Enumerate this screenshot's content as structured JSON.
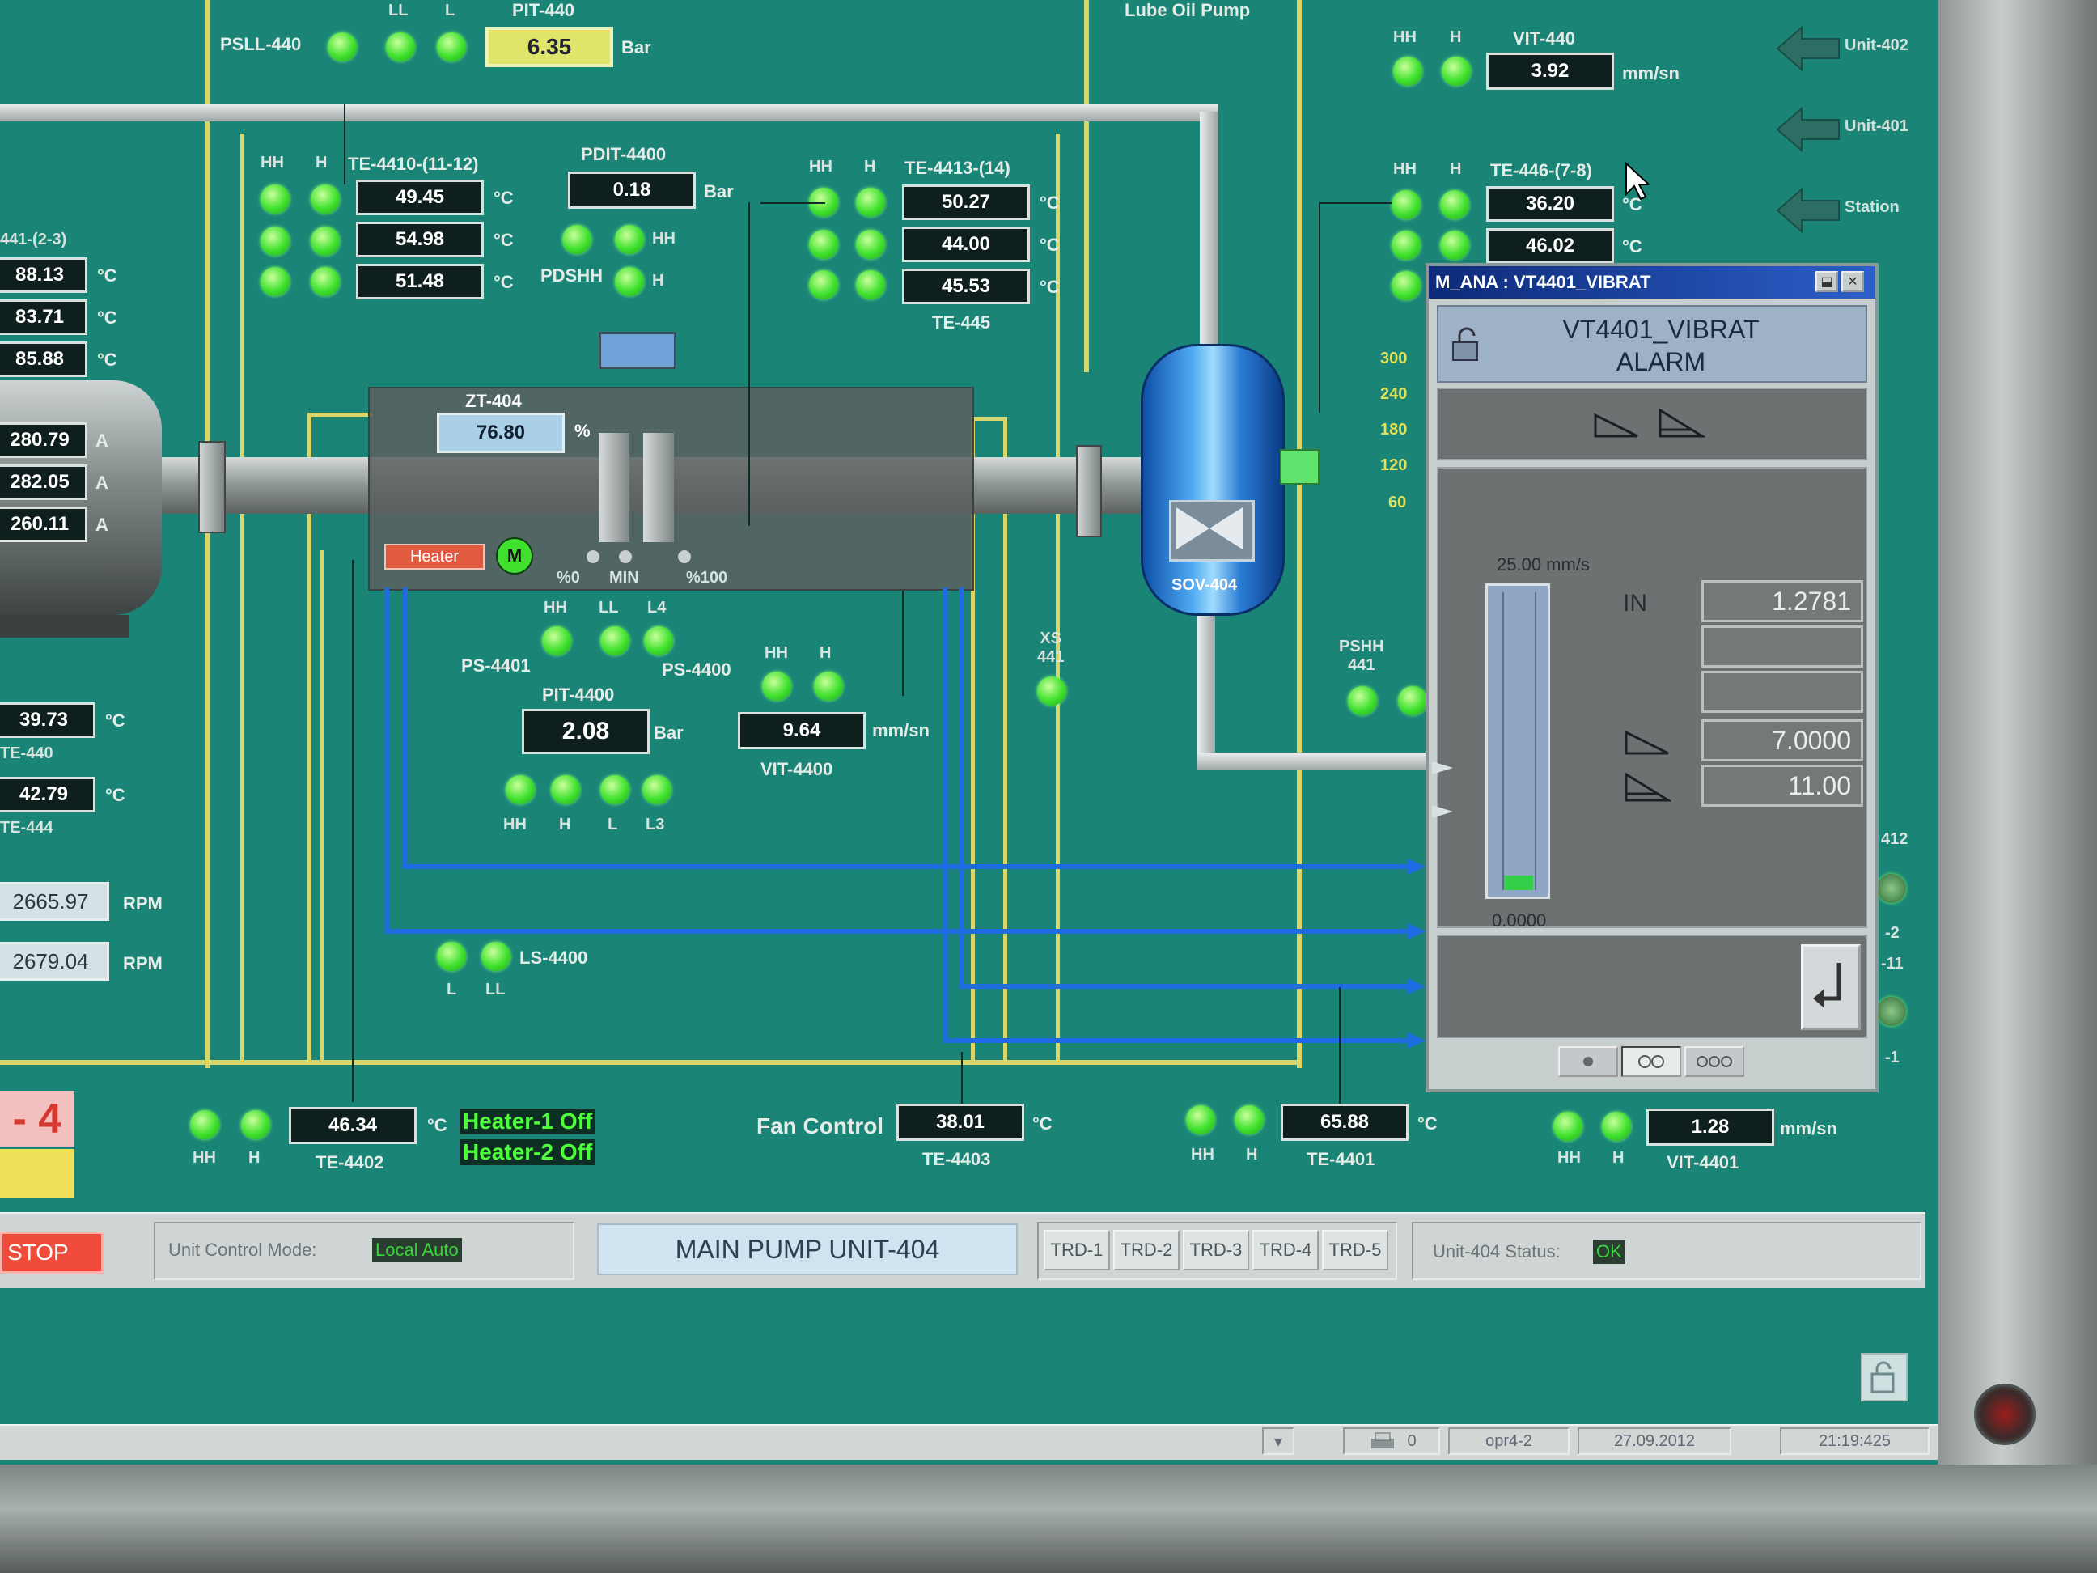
{
  "top": {
    "psll_label": "PSLL-440",
    "ll_label": "LL",
    "l_label": "L",
    "pit440_tag": "PIT-440",
    "pit440_value": "6.35",
    "pit440_unit": "Bar",
    "lube_oil_label": "Lube Oil Pump",
    "vit440_tag": "VIT-440",
    "vit440_value": "3.92",
    "vit440_unit": "mm/sn",
    "hh": "HH",
    "h": "H"
  },
  "right_nav": {
    "unit402": "Unit-402",
    "unit401": "Unit-401",
    "station": "Station"
  },
  "left_temps": {
    "tag": "441-(2-3)",
    "values": [
      "88.13",
      "83.71",
      "85.88"
    ],
    "unit": "°C",
    "amps": [
      "280.79",
      "282.05",
      "260.11"
    ],
    "amp_unit": "A",
    "te440_value": "39.73",
    "te440_tag": "TE-440",
    "te444_value": "42.79",
    "te444_tag": "TE-444",
    "rpm_values": [
      "2665.97",
      "2679.04"
    ],
    "rpm_unit": "RPM"
  },
  "te4410": {
    "tag": "TE-4410-(11-12)",
    "values": [
      "49.45",
      "54.98",
      "51.48"
    ],
    "unit": "°C"
  },
  "pdit4400": {
    "tag": "PDIT-4400",
    "value": "0.18",
    "unit": "Bar",
    "pdshh": "PDSHH",
    "hh": "HH",
    "h": "H"
  },
  "te4413": {
    "tag": "TE-4413-(14)",
    "values": [
      "50.27",
      "44.00",
      "45.53"
    ],
    "unit": "°C",
    "te445": "TE-445"
  },
  "te446": {
    "tag": "TE-446-(7-8)",
    "values": [
      "36.20",
      "46.02"
    ],
    "unit": "°C"
  },
  "pump": {
    "zt_tag": "ZT-404",
    "zt_value": "76.80",
    "zt_unit": "%",
    "heater": "Heater",
    "motor": "M",
    "pos0": "%0",
    "min": "MIN",
    "pos100": "%100"
  },
  "sov": {
    "label": "SOV-404"
  },
  "gauge_scale": [
    "300",
    "240",
    "180",
    "120",
    "60"
  ],
  "ps": {
    "ps4401": "PS-4401",
    "ps4400": "PS-4400",
    "hh": "HH",
    "ll": "LL",
    "l4": "L4",
    "pit4400_tag": "PIT-4400",
    "pit4400_value": "2.08",
    "pit4400_unit": "Bar",
    "vit4400_value": "9.64",
    "vit4400_unit": "mm/sn",
    "vit4400_tag": "VIT-4400",
    "h": "H",
    "l": "L",
    "l3": "L3",
    "xs441": "XS\n441",
    "pshh441": "PSHH\n441"
  },
  "ls4400": {
    "tag": "LS-4400",
    "l": "L",
    "ll": "LL"
  },
  "bottom": {
    "te4402_value": "46.34",
    "te4402_tag": "TE-4402",
    "heater1": "Heater-1 Off",
    "heater2": "Heater-2 Off",
    "fan_control": "Fan Control",
    "te4403_value": "38.01",
    "te4403_tag": "TE-4403",
    "te4401_value": "65.88",
    "te4401_tag": "TE-4401",
    "vit4401_value": "1.28",
    "vit4401_unit": "mm/sn",
    "vit4401_tag": "VIT-4401",
    "unit_big": "- 4",
    "side_labels": [
      "412",
      "-2",
      "-11",
      "-1"
    ]
  },
  "popup": {
    "title": "M_ANA : VT4401_VIBRAT",
    "name_line1": "VT4401_VIBRAT",
    "name_line2": "ALARM",
    "range_max": "25.00 mm/s",
    "range_min": "0.0000",
    "in_label": "IN",
    "in_value": "1.2781",
    "limit_h": "7.0000",
    "limit_hh": "11.00",
    "bar_fraction": 0.05
  },
  "control_bar": {
    "stop": "STOP",
    "mode_label": "Unit Control Mode:",
    "mode_value": "Local Auto",
    "title": "MAIN PUMP UNIT-404",
    "trd": [
      "TRD-1",
      "TRD-2",
      "TRD-3",
      "TRD-4",
      "TRD-5"
    ],
    "status_label": "Unit-404 Status:",
    "status_value": "OK"
  },
  "status_bar": {
    "count": "0",
    "user": "opr4-2",
    "date": "27.09.2012",
    "time": "21:19:425"
  },
  "colors": {
    "background": "#1a8577",
    "led": "#3fe12e",
    "flow_line": "#1f6be0",
    "wall": "#d8d66a",
    "alarm_red": "#f04a3a"
  }
}
